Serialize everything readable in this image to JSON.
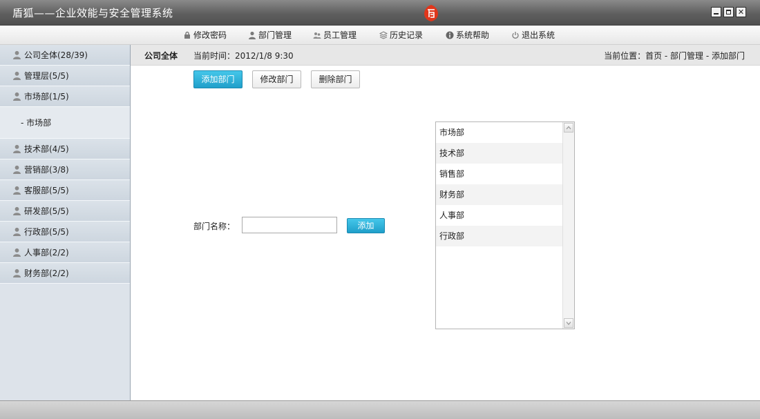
{
  "window": {
    "title": "盾狐——企业效能与安全管理系统",
    "logo_char": "盾",
    "controls": {
      "minimize": "minimize",
      "maximize": "maximize",
      "close": "✕"
    }
  },
  "toolbar": {
    "items": [
      {
        "label": "修改密码",
        "icon": "lock-icon"
      },
      {
        "label": "部门管理",
        "icon": "person-icon"
      },
      {
        "label": "员工管理",
        "icon": "people-icon"
      },
      {
        "label": "历史记录",
        "icon": "layers-icon"
      },
      {
        "label": "系统帮助",
        "icon": "info-icon"
      },
      {
        "label": "退出系统",
        "icon": "power-icon"
      }
    ]
  },
  "sidebar": {
    "items": [
      {
        "label": "公司全体(28/39)"
      },
      {
        "label": "管理层(5/5)"
      },
      {
        "label": "市场部(1/5)"
      },
      {
        "label": "技术部(4/5)"
      },
      {
        "label": "营销部(3/8)"
      },
      {
        "label": "客服部(5/5)"
      },
      {
        "label": "研发部(5/5)"
      },
      {
        "label": "行政部(5/5)"
      },
      {
        "label": "人事部(2/2)"
      },
      {
        "label": "财务部(2/2)"
      }
    ],
    "expanded_sub": "- 市场部"
  },
  "header": {
    "company": "公司全体",
    "time": "当前时间：2012/1/8 9:30",
    "location": "当前位置：首页 - 部门管理 - 添加部门"
  },
  "actions": {
    "add_dept": "添加部门",
    "edit_dept": "修改部门",
    "delete_dept": "删除部门"
  },
  "form": {
    "label": "部门名称：",
    "value": "",
    "submit": "添加"
  },
  "dept_list": [
    "市场部",
    "技术部",
    "销售部",
    "财务部",
    "人事部",
    "行政部"
  ],
  "colors": {
    "primary_button": "#1f9fca",
    "sidebar_bg": "#dde3ea",
    "titlebar_bg": "#5f5f5f",
    "logo_red": "#e0361b"
  }
}
